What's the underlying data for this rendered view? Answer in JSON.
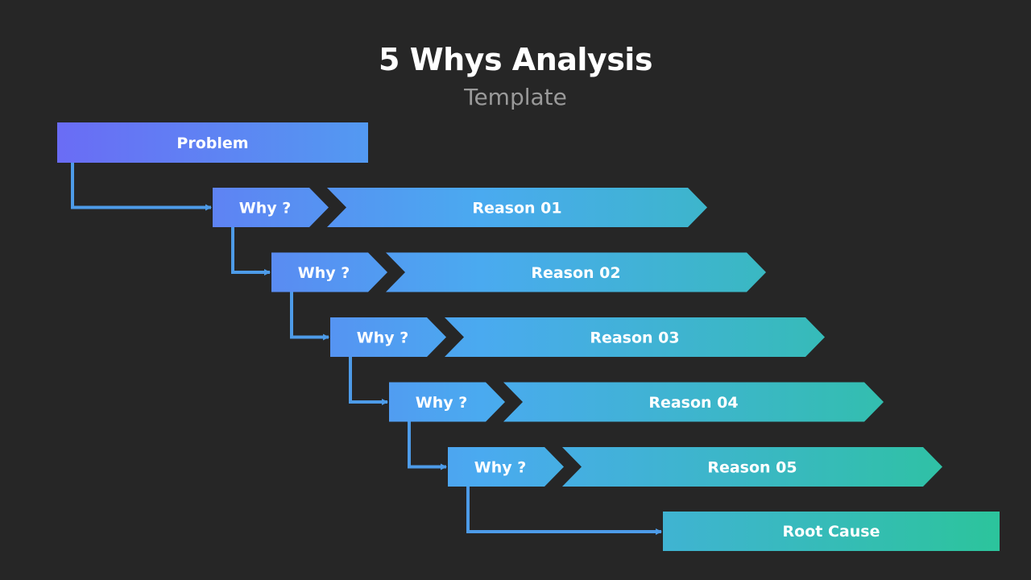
{
  "header": {
    "title": "5 Whys Analysis",
    "subtitle": "Template"
  },
  "colors": {
    "background": "#262626",
    "gradient_start": "#6a6cf5",
    "gradient_mid": "#4aaaf0",
    "gradient_end": "#2cc49c",
    "connector": "#4d9be8"
  },
  "problem": {
    "label": "Problem"
  },
  "steps": [
    {
      "why_label": "Why ?",
      "reason_label": "Reason 01"
    },
    {
      "why_label": "Why ?",
      "reason_label": "Reason 02"
    },
    {
      "why_label": "Why ?",
      "reason_label": "Reason 03"
    },
    {
      "why_label": "Why ?",
      "reason_label": "Reason 04"
    },
    {
      "why_label": "Why ?",
      "reason_label": "Reason 05"
    }
  ],
  "root_cause": {
    "label": "Root Cause"
  }
}
